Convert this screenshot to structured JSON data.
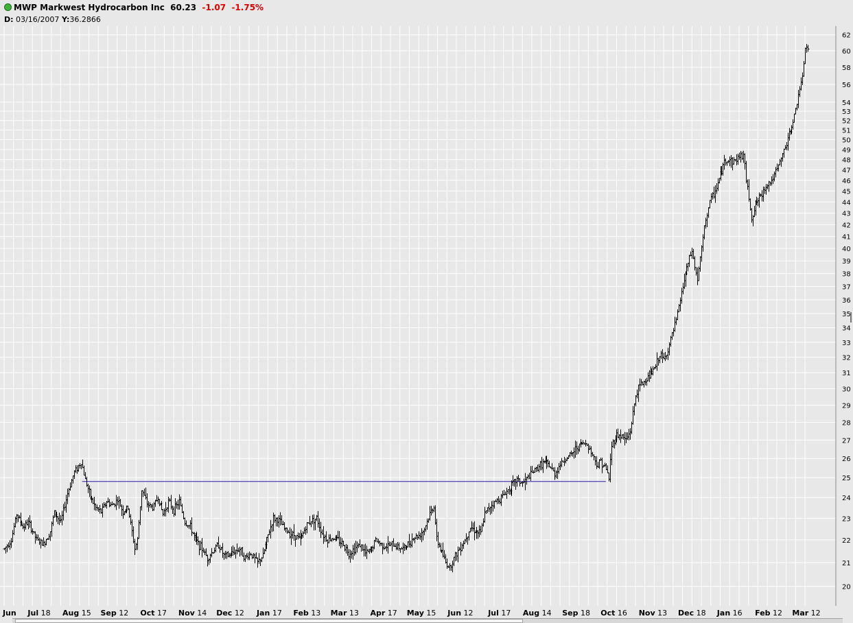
{
  "header": {
    "symbol": "MWP",
    "name": "Markwest Hydrocarbon Inc",
    "last": "60.23",
    "change": "-1.07",
    "change_pct": "-1.75%",
    "cursor_date_label": "D:",
    "cursor_date": "03/16/2007",
    "cursor_y_label": "Y:",
    "cursor_y": "36.2866"
  },
  "colors": {
    "background": "#e8e8e8",
    "gridline": "#ffffff",
    "bars": "#000000",
    "trendline": "#2a1aa8",
    "negative": "#e00000"
  },
  "chart_data": {
    "type": "ohlc-bar",
    "yscale": "log",
    "ylim": [
      19.6,
      62.5
    ],
    "yticks": [
      20,
      21,
      22,
      23,
      24,
      25,
      26,
      27,
      28,
      29,
      30,
      31,
      32,
      33,
      34,
      35,
      36,
      37,
      38,
      39,
      40,
      41,
      42,
      43,
      44,
      45,
      46,
      47,
      48,
      49,
      50,
      51,
      52,
      53,
      54,
      56,
      58,
      60,
      62
    ],
    "xlim": [
      0,
      597
    ],
    "x_axis": [
      {
        "month": "Jun",
        "day": "",
        "idx": 4
      },
      {
        "month": "Jul",
        "day": "18",
        "idx": 26
      },
      {
        "month": "Aug",
        "day": "15",
        "idx": 54
      },
      {
        "month": "Sep",
        "day": "12",
        "idx": 82
      },
      {
        "month": "Oct",
        "day": "17",
        "idx": 111
      },
      {
        "month": "Nov",
        "day": "14",
        "idx": 140
      },
      {
        "month": "Dec",
        "day": "12",
        "idx": 168
      },
      {
        "month": "Jan",
        "day": "17",
        "idx": 197
      },
      {
        "month": "Feb",
        "day": "13",
        "idx": 225
      },
      {
        "month": "Mar",
        "day": "13",
        "idx": 253
      },
      {
        "month": "Apr",
        "day": "17",
        "idx": 282
      },
      {
        "month": "May",
        "day": "15",
        "idx": 310
      },
      {
        "month": "Jun",
        "day": "12",
        "idx": 339
      },
      {
        "month": "Jul",
        "day": "17",
        "idx": 368
      },
      {
        "month": "Aug",
        "day": "14",
        "idx": 396
      },
      {
        "month": "Sep",
        "day": "18",
        "idx": 425
      },
      {
        "month": "Oct",
        "day": "16",
        "idx": 453
      },
      {
        "month": "Nov",
        "day": "13",
        "idx": 482
      },
      {
        "month": "Dec",
        "day": "18",
        "idx": 511
      },
      {
        "month": "Jan",
        "day": "16",
        "idx": 539
      },
      {
        "month": "Feb",
        "day": "12",
        "idx": 568
      },
      {
        "month": "Mar",
        "day": "12",
        "idx": 596
      }
    ],
    "trendline": {
      "x1": 58,
      "y1": 24.8,
      "x2": 447,
      "y2": 24.8
    },
    "price_anchors": [
      [
        0,
        21.6
      ],
      [
        5,
        22.0
      ],
      [
        9,
        23.2
      ],
      [
        14,
        22.6
      ],
      [
        18,
        22.8
      ],
      [
        24,
        22.0
      ],
      [
        29,
        21.8
      ],
      [
        34,
        22.4
      ],
      [
        37,
        23.3
      ],
      [
        42,
        22.8
      ],
      [
        47,
        24.2
      ],
      [
        52,
        25.3
      ],
      [
        57,
        25.8
      ],
      [
        60,
        24.9
      ],
      [
        64,
        24.0
      ],
      [
        68,
        23.5
      ],
      [
        72,
        23.3
      ],
      [
        76,
        23.8
      ],
      [
        80,
        23.6
      ],
      [
        84,
        23.9
      ],
      [
        88,
        23.3
      ],
      [
        92,
        23.5
      ],
      [
        97,
        21.6
      ],
      [
        99,
        22.0
      ],
      [
        102,
        24.4
      ],
      [
        106,
        23.7
      ],
      [
        110,
        23.5
      ],
      [
        114,
        24.0
      ],
      [
        118,
        23.2
      ],
      [
        122,
        23.8
      ],
      [
        126,
        23.4
      ],
      [
        130,
        23.8
      ],
      [
        134,
        22.8
      ],
      [
        138,
        22.6
      ],
      [
        142,
        22.0
      ],
      [
        147,
        21.6
      ],
      [
        151,
        21.2
      ],
      [
        155,
        21.5
      ],
      [
        159,
        21.8
      ],
      [
        163,
        21.3
      ],
      [
        167,
        21.3
      ],
      [
        171,
        21.5
      ],
      [
        175,
        21.6
      ],
      [
        179,
        21.2
      ],
      [
        183,
        21.4
      ],
      [
        188,
        21.0
      ],
      [
        192,
        21.3
      ],
      [
        196,
        22.2
      ],
      [
        200,
        23.0
      ],
      [
        204,
        22.9
      ],
      [
        208,
        22.5
      ],
      [
        212,
        22.3
      ],
      [
        216,
        22.2
      ],
      [
        220,
        22.0
      ],
      [
        224,
        22.6
      ],
      [
        228,
        22.9
      ],
      [
        232,
        23.0
      ],
      [
        236,
        22.3
      ],
      [
        240,
        22.0
      ],
      [
        244,
        22.1
      ],
      [
        248,
        22.0
      ],
      [
        252,
        21.8
      ],
      [
        256,
        21.4
      ],
      [
        260,
        21.6
      ],
      [
        264,
        21.8
      ],
      [
        268,
        21.4
      ],
      [
        272,
        21.5
      ],
      [
        276,
        22.0
      ],
      [
        280,
        21.8
      ],
      [
        284,
        21.7
      ],
      [
        288,
        21.8
      ],
      [
        292,
        21.7
      ],
      [
        296,
        21.6
      ],
      [
        300,
        21.8
      ],
      [
        304,
        22.1
      ],
      [
        308,
        22.2
      ],
      [
        312,
        22.5
      ],
      [
        316,
        23.2
      ],
      [
        319,
        23.6
      ],
      [
        321,
        22.0
      ],
      [
        324,
        21.6
      ],
      [
        328,
        21.0
      ],
      [
        331,
        20.8
      ],
      [
        334,
        21.2
      ],
      [
        338,
        21.6
      ],
      [
        342,
        22.0
      ],
      [
        346,
        22.6
      ],
      [
        350,
        22.4
      ],
      [
        354,
        22.3
      ],
      [
        357,
        23.2
      ],
      [
        361,
        23.6
      ],
      [
        365,
        23.8
      ],
      [
        369,
        24.0
      ],
      [
        373,
        24.3
      ],
      [
        377,
        24.6
      ],
      [
        381,
        24.9
      ],
      [
        385,
        24.7
      ],
      [
        389,
        25.0
      ],
      [
        393,
        25.3
      ],
      [
        397,
        25.6
      ],
      [
        401,
        25.8
      ],
      [
        405,
        25.6
      ],
      [
        409,
        25.2
      ],
      [
        413,
        25.7
      ],
      [
        417,
        26.0
      ],
      [
        421,
        26.2
      ],
      [
        425,
        26.6
      ],
      [
        429,
        26.8
      ],
      [
        433,
        26.8
      ],
      [
        437,
        26.2
      ],
      [
        441,
        25.6
      ],
      [
        443,
        25.9
      ],
      [
        447,
        25.4
      ],
      [
        449,
        25.0
      ],
      [
        451,
        26.7
      ],
      [
        455,
        27.3
      ],
      [
        459,
        27.2
      ],
      [
        462,
        27.0
      ],
      [
        465,
        27.5
      ],
      [
        467,
        28.5
      ],
      [
        469,
        29.6
      ],
      [
        472,
        30.2
      ],
      [
        476,
        30.5
      ],
      [
        480,
        30.9
      ],
      [
        484,
        31.4
      ],
      [
        487,
        32.2
      ],
      [
        490,
        31.8
      ],
      [
        493,
        32.5
      ],
      [
        496,
        33.5
      ],
      [
        499,
        34.5
      ],
      [
        502,
        36.0
      ],
      [
        505,
        37.5
      ],
      [
        508,
        38.8
      ],
      [
        511,
        39.8
      ],
      [
        513,
        38.5
      ],
      [
        515,
        37.5
      ],
      [
        518,
        40.0
      ],
      [
        521,
        42.5
      ],
      [
        524,
        44.0
      ],
      [
        528,
        45.0
      ],
      [
        532,
        46.5
      ],
      [
        535,
        47.8
      ],
      [
        539,
        48.0
      ],
      [
        542,
        47.8
      ],
      [
        546,
        48.3
      ],
      [
        549,
        48.5
      ],
      [
        551,
        46.0
      ],
      [
        553,
        44.5
      ],
      [
        555,
        42.5
      ],
      [
        558,
        43.8
      ],
      [
        562,
        44.5
      ],
      [
        566,
        45.5
      ],
      [
        570,
        46.0
      ],
      [
        574,
        47.0
      ],
      [
        578,
        48.5
      ],
      [
        582,
        50.0
      ],
      [
        585,
        51.5
      ],
      [
        588,
        53.0
      ],
      [
        590,
        55.0
      ],
      [
        593,
        56.5
      ],
      [
        595,
        60.5
      ],
      [
        597,
        60.2
      ]
    ]
  }
}
